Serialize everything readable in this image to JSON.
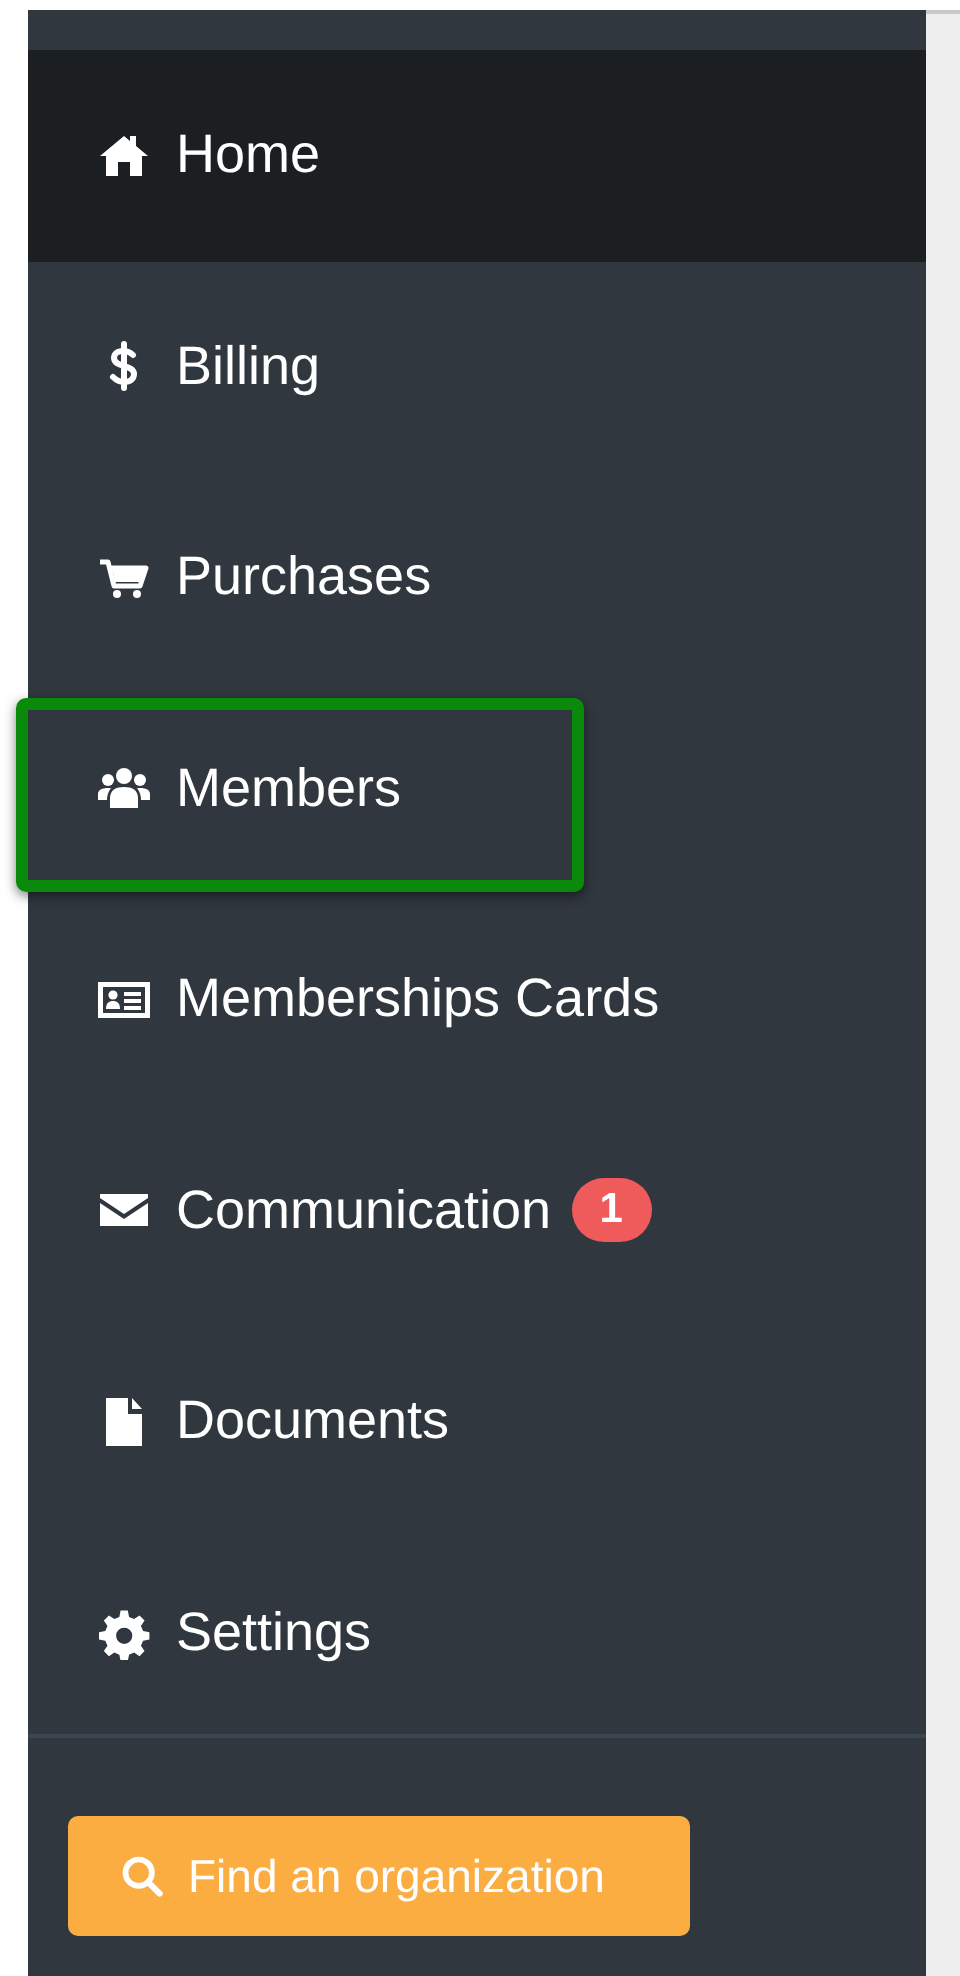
{
  "sidebar": {
    "items": [
      {
        "label": "Home",
        "selected": true,
        "highlighted": false
      },
      {
        "label": "Billing",
        "selected": false,
        "highlighted": false
      },
      {
        "label": "Purchases",
        "selected": false,
        "highlighted": false
      },
      {
        "label": "Members",
        "selected": false,
        "highlighted": true
      },
      {
        "label": "Memberships Cards",
        "selected": false,
        "highlighted": false
      },
      {
        "label": "Communication",
        "selected": false,
        "highlighted": false,
        "badge": "1"
      },
      {
        "label": "Documents",
        "selected": false,
        "highlighted": false
      },
      {
        "label": "Settings",
        "selected": false,
        "highlighted": false
      }
    ],
    "button": {
      "label": "Find an organization"
    }
  }
}
